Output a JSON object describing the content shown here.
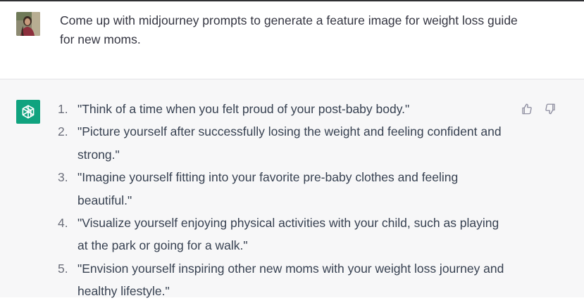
{
  "user_message": {
    "text": "Come up with midjourney prompts to generate a feature image for weight loss guide for new moms."
  },
  "assistant_message": {
    "items": [
      {
        "number": "1.",
        "text": "\"Think of a time when you felt proud of your post-baby body.\""
      },
      {
        "number": "2.",
        "text": "\"Picture yourself after successfully losing the weight and feeling confident and strong.\""
      },
      {
        "number": "3.",
        "text": "\"Imagine yourself fitting into your favorite pre-baby clothes and feeling beautiful.\""
      },
      {
        "number": "4.",
        "text": "\"Visualize yourself enjoying physical activities with your child, such as playing at the park or going for a walk.\""
      },
      {
        "number": "5.",
        "text": "\"Envision yourself inspiring other new moms with your weight loss journey and healthy lifestyle.\""
      }
    ]
  },
  "icons": {
    "user_avatar": "user-photo",
    "assistant_avatar": "openai-logo-icon",
    "thumbs_up": "thumbs-up-icon",
    "thumbs_down": "thumbs-down-icon"
  },
  "colors": {
    "assistant_avatar_bg": "#10a37f",
    "assistant_bg": "#f7f7f8",
    "text": "#374151"
  }
}
